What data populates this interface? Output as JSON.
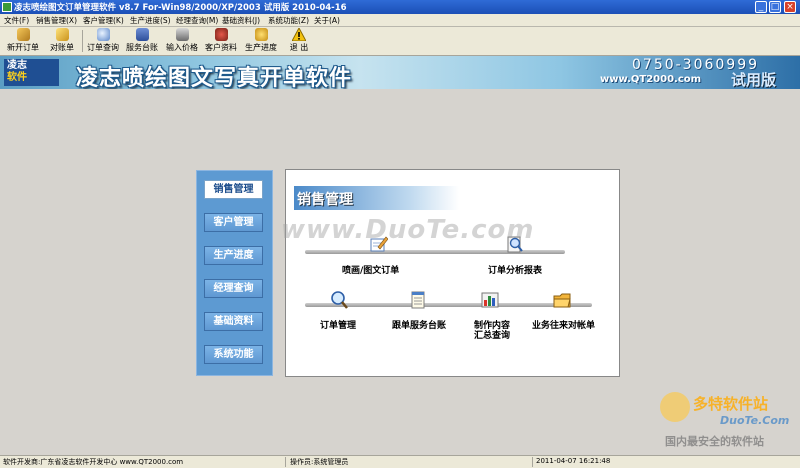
{
  "window": {
    "title": "凌志喷绘图文订单管理软件 v8.7 For-Win98/2000/XP/2003  试用版  2010-04-16",
    "controls": [
      "_",
      "□",
      "×"
    ]
  },
  "menu": [
    "文件(F)",
    "销售管理(X)",
    "客户管理(K)",
    "生产进度(S)",
    "经理查询(M)",
    "基础资料(J)",
    "系统功能(Z)",
    "关于(A)"
  ],
  "toolbar": [
    {
      "label": "新开订单",
      "icon": "new-order-icon"
    },
    {
      "label": "对账单",
      "icon": "statement-icon"
    },
    {
      "label": "订单查询",
      "icon": "order-query-icon"
    },
    {
      "label": "服务台账",
      "icon": "service-ledger-icon"
    },
    {
      "label": "输入价格",
      "icon": "price-input-icon"
    },
    {
      "label": "客户资料",
      "icon": "customer-info-icon"
    },
    {
      "label": "生产进度",
      "icon": "production-icon"
    },
    {
      "label": "退  出",
      "icon": "exit-icon"
    }
  ],
  "banner": {
    "logo_top": "凌志",
    "logo_bottom": "软件",
    "title": "凌志喷绘图文写真开单软件",
    "phone": "0750-3060999",
    "website": "www.QT2000.com",
    "edition": "试用版"
  },
  "sidebar": [
    {
      "label": "销售管理",
      "active": true
    },
    {
      "label": "客户管理",
      "active": false
    },
    {
      "label": "生产进度",
      "active": false
    },
    {
      "label": "经理查询",
      "active": false
    },
    {
      "label": "基础资料",
      "active": false
    },
    {
      "label": "系统功能",
      "active": false
    }
  ],
  "panel": {
    "heading": "销售管理",
    "items": [
      {
        "label": "喷画/图文订单",
        "icon": "order-pen-icon"
      },
      {
        "label": "订单分析报表",
        "icon": "report-magnifier-icon"
      },
      {
        "label": "订单管理",
        "icon": "magnifier-icon"
      },
      {
        "label": "跟单服务台账",
        "icon": "notepad-icon"
      },
      {
        "label": "制作内容\n汇总查询",
        "icon": "summary-chart-icon"
      },
      {
        "label": "业务往来对帐单",
        "icon": "folder-icon"
      }
    ]
  },
  "watermarks": {
    "main": "www.DuoTe.com",
    "corner_brand": "多特软件站",
    "corner_site": "DuoTe.Com",
    "corner_slogan": "国内最安全的软件站"
  },
  "status": {
    "developer": "软件开发商:广东省凌志软件开发中心 www.QT2000.com",
    "operator": "操作员:系统管理员",
    "datetime": "2011-04-07 16:21:48"
  },
  "colors": {
    "titlebar": "#1b4fb6",
    "sidebar": "#5d9ad2",
    "panel_bg": "#ffffff",
    "workspace": "#d6d3ce"
  }
}
